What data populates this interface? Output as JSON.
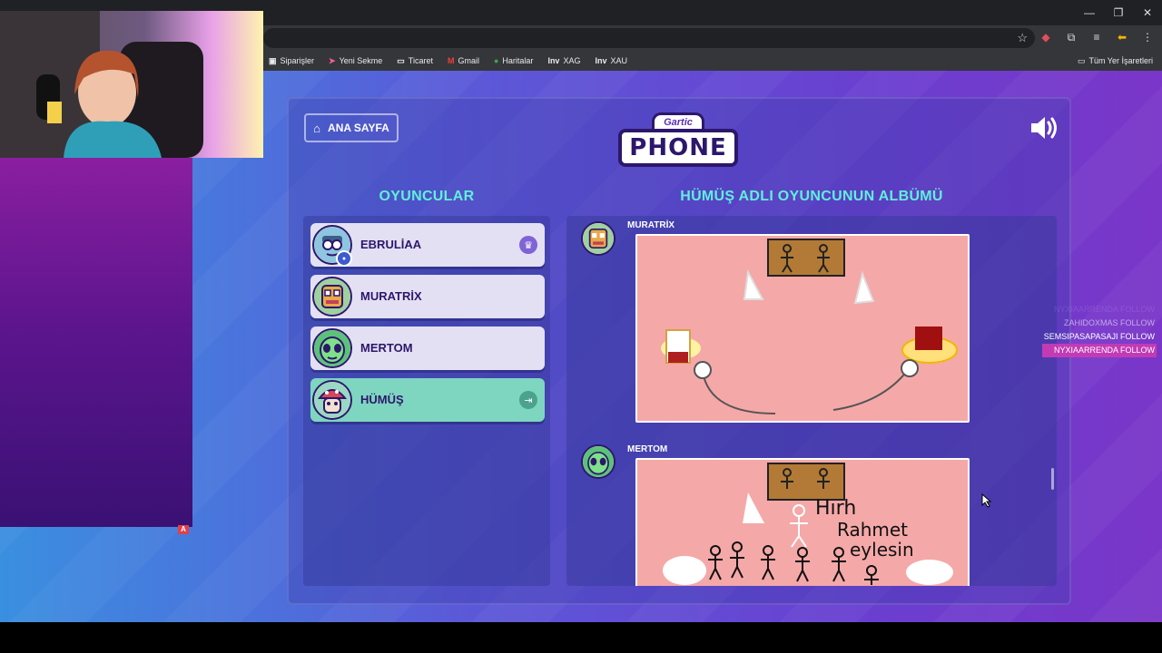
{
  "browser": {
    "window_controls": [
      "—",
      "❐",
      "✕"
    ],
    "bookmarks": [
      {
        "label": "Siparişler",
        "icon": "orders-icon",
        "glyph": "▣",
        "color": "#e8eaed"
      },
      {
        "label": "Yeni Sekme",
        "icon": "new-tab-icon",
        "glyph": "➤",
        "color": "#f06292"
      },
      {
        "label": "Ticaret",
        "icon": "folder-icon",
        "glyph": "▭",
        "color": "#e8eaed"
      },
      {
        "label": "Gmail",
        "icon": "gmail-icon",
        "glyph": "M",
        "color": "#ea4335"
      },
      {
        "label": "Haritalar",
        "icon": "maps-icon",
        "glyph": "●",
        "color": "#34a853"
      },
      {
        "label": "XAG",
        "icon": "investing-icon",
        "glyph": "Inv",
        "color": "#e8eaed"
      },
      {
        "label": "XAU",
        "icon": "investing-icon",
        "glyph": "Inv",
        "color": "#e8eaed"
      }
    ],
    "all_bookmarks_label": "Tüm Yer İşaretleri"
  },
  "game": {
    "home_button": "ANA SAYFA",
    "logo_top": "Gartic",
    "logo_main": "PHONE",
    "players_heading": "OYUNCULAR",
    "album_heading": "HÜMÜŞ ADLI OYUNCUNUN ALBÜMÜ",
    "players": [
      {
        "name": "EBRULİAA",
        "badge": "crown",
        "active": false
      },
      {
        "name": "MURATRİX",
        "badge": "",
        "active": false
      },
      {
        "name": "MERTOM",
        "badge": "",
        "active": false
      },
      {
        "name": "HÜMÜŞ",
        "badge": "exit",
        "active": true
      }
    ],
    "album": [
      {
        "author": "MURATRİX"
      },
      {
        "author": "MERTOM"
      }
    ],
    "drawing_text": [
      "Hırh",
      "Rahmet",
      "eylesin"
    ]
  },
  "stream": {
    "follows": [
      {
        "text": "NYXIAARRENDA  FOLLOW",
        "style": "faded"
      },
      {
        "text": "ZAHIDOXMAS  FOLLOW",
        "style": "dim"
      },
      {
        "text": "SEMSIPASAPASAJI  FOLLOW",
        "style": "bright"
      },
      {
        "text": "NYXIAARRENDA  FOLLOW",
        "style": "highlight"
      }
    ],
    "colors": {
      "highlight": "#c23bb5"
    }
  }
}
